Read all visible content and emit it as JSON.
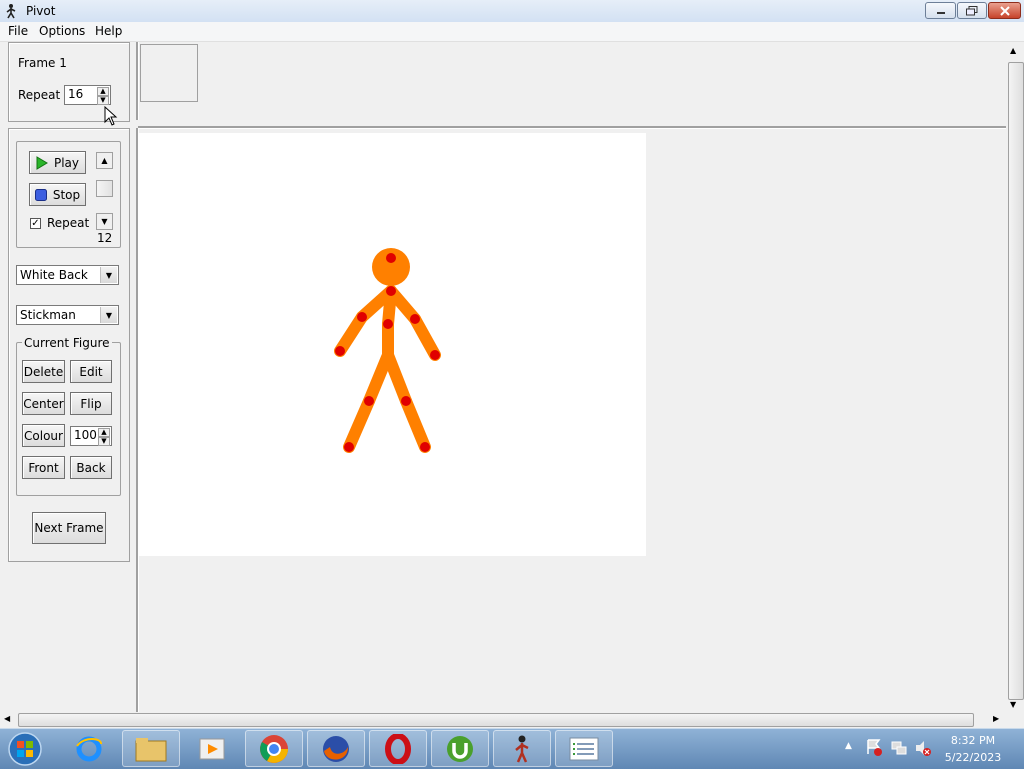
{
  "window": {
    "title": "Pivot"
  },
  "menu": [
    "File",
    "Options",
    "Help"
  ],
  "frame_panel": {
    "frame_label": "Frame 1",
    "repeat_label": "Repeat :",
    "repeat_value": "16"
  },
  "playback": {
    "play_label": "Play",
    "stop_label": "Stop",
    "repeat_label": "Repeat",
    "repeat_checked": true,
    "speed_value": "12"
  },
  "background_select": {
    "value": "White Back"
  },
  "figure_type_select": {
    "value": "Stickman"
  },
  "current_figure": {
    "title": "Current Figure",
    "delete_label": "Delete",
    "edit_label": "Edit",
    "center_label": "Center",
    "flip_label": "Flip",
    "colour_label": "Colour",
    "colour_value": "100",
    "front_label": "Front",
    "back_label": "Back"
  },
  "next_frame_label": "Next Frame",
  "colors": {
    "figure": "#ff8000",
    "joint": "#e00000",
    "canvas": "#ffffff"
  },
  "taskbar": {
    "apps": [
      "start-orb",
      "internet-explorer-icon",
      "file-explorer-icon",
      "media-player-icon",
      "chrome-icon",
      "firefox-icon",
      "opera-icon",
      "utorrent-icon",
      "pivot-icon",
      "document-list-icon"
    ],
    "time": "8:32 PM",
    "date": "5/22/2023"
  }
}
